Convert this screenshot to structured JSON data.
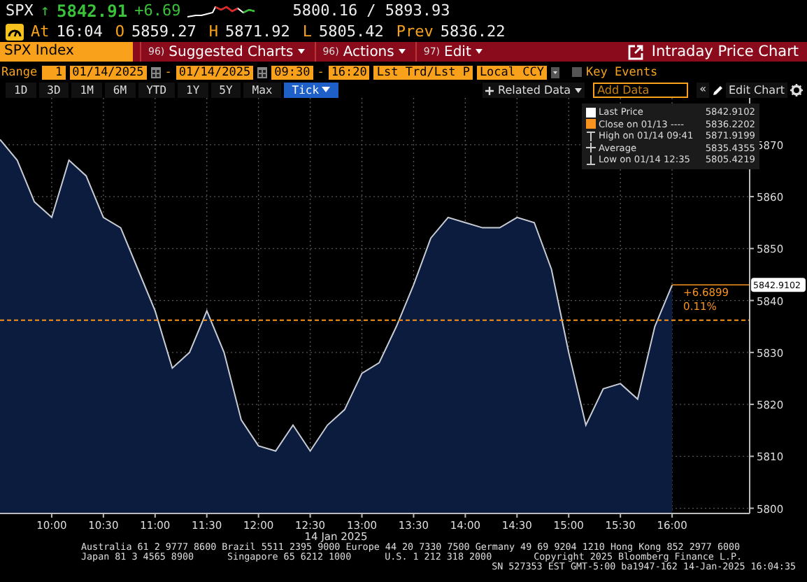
{
  "quote": {
    "ticker": "SPX",
    "arrow": "↑",
    "last": "5842.91",
    "change": "+6.69",
    "range": "5800.16 / 5893.93"
  },
  "stats": [
    {
      "label": "At",
      "value": "16:04"
    },
    {
      "label": "O",
      "value": "5859.27"
    },
    {
      "label": "H",
      "value": "5871.92"
    },
    {
      "label": "L",
      "value": "5805.42"
    },
    {
      "label": "Prev",
      "value": "5836.22"
    }
  ],
  "toolbar": {
    "security": "SPX Index",
    "menus": [
      {
        "code": "96)",
        "label": "Suggested Charts"
      },
      {
        "code": "96)",
        "label": "Actions"
      },
      {
        "code": "97)",
        "label": "Edit"
      }
    ],
    "title": "Intraday Price Chart"
  },
  "range_bar": {
    "label": "Range",
    "count": "1",
    "start_date": "01/14/2025",
    "date_separator": "-",
    "end_date": "01/14/2025",
    "start_time": "09:30",
    "time_separator": "-",
    "end_time": "16:20",
    "price_field": "Lst Trd/Lst P",
    "currency": "Local CCY",
    "key_events": {
      "label": "Key Events",
      "checked": false
    }
  },
  "period_buttons": [
    {
      "label": "1D",
      "selected": false
    },
    {
      "label": "3D",
      "selected": false
    },
    {
      "label": "1M",
      "selected": false
    },
    {
      "label": "6M",
      "selected": false
    },
    {
      "label": "YTD",
      "selected": false
    },
    {
      "label": "1Y",
      "selected": false
    },
    {
      "label": "5Y",
      "selected": false
    },
    {
      "label": "Max",
      "selected": false
    },
    {
      "label": "Tick",
      "selected": true
    }
  ],
  "chart_tools": {
    "related_data": "Related Data",
    "add_data_placeholder": "Add Data",
    "collapse": "«",
    "edit_chart": "Edit Chart"
  },
  "chart": {
    "legend": [
      {
        "kind": "square",
        "color": "#ffffff",
        "label": "Last Price",
        "value": "5842.9102"
      },
      {
        "kind": "square",
        "color": "#f7931e",
        "label": "Close on 01/13 ----",
        "value": "5836.2202"
      },
      {
        "kind": "high",
        "label": "High on 01/14 09:41",
        "value": "5871.9199"
      },
      {
        "kind": "average",
        "label": "Average",
        "value": "5835.4355"
      },
      {
        "kind": "low",
        "label": "Low on 01/14 12:35",
        "value": "5805.4219"
      }
    ],
    "last_tag": "5842.9102",
    "change_tag": "+6.6899",
    "percent_tag": "0.11%",
    "chart_data": {
      "type": "area",
      "xlabel": "14 Jan 2025",
      "x": [
        570,
        580,
        590,
        600,
        610,
        620,
        630,
        640,
        650,
        660,
        670,
        680,
        690,
        700,
        710,
        720,
        730,
        740,
        750,
        760,
        770,
        780,
        790,
        800,
        810,
        820,
        830,
        840,
        850,
        860,
        870,
        880,
        890,
        900,
        910,
        920,
        930,
        940,
        950,
        960
      ],
      "series": [
        {
          "color": "#0c1c3e",
          "values": [
            5871,
            5867,
            5859,
            5856,
            5867,
            5864,
            5856,
            5854,
            5846,
            5838,
            5827,
            5830,
            5838,
            5830,
            5817,
            5812,
            5811,
            5816,
            5811,
            5816,
            5819,
            5826,
            5828,
            5835,
            5843,
            5852,
            5856,
            5855,
            5854,
            5854,
            5856,
            5855,
            5846,
            5830,
            5816,
            5823,
            5824,
            5821,
            5835,
            5843
          ]
        }
      ],
      "xlim": [
        570,
        1005
      ],
      "ylim": [
        5799,
        5879
      ],
      "grid": true,
      "yticks": [
        5800,
        5810,
        5820,
        5830,
        5840,
        5850,
        5860,
        5870
      ],
      "xticks": [
        {
          "value": 600,
          "label": "10:00"
        },
        {
          "value": 630,
          "label": "10:30"
        },
        {
          "value": 660,
          "label": "11:00"
        },
        {
          "value": 690,
          "label": "11:30"
        },
        {
          "value": 720,
          "label": "12:00"
        },
        {
          "value": 750,
          "label": "12:30"
        },
        {
          "value": 780,
          "label": "13:00"
        },
        {
          "value": 810,
          "label": "13:30"
        },
        {
          "value": 840,
          "label": "14:00"
        },
        {
          "value": 870,
          "label": "14:30"
        },
        {
          "value": 900,
          "label": "15:00"
        },
        {
          "value": 930,
          "label": "15:30"
        },
        {
          "value": 960,
          "label": "16:00"
        }
      ],
      "ref_lines": [
        {
          "axis": "y",
          "value": 5836.22
        }
      ]
    }
  },
  "footer": {
    "line1": "Australia 61 2 9777 8600 Brazil 5511 2395 9000 Europe 44 20 7330 7500 Germany 49 69 9204 1210 Hong Kong 852 2977 6000",
    "line2": [
      "Japan 81 3 4565 8900",
      "Singapore 65 6212 1000",
      "U.S. 1 212 318 2000",
      "Copyright 2025 Bloomberg Finance L.P."
    ],
    "line3": "SN 527353 EST  GMT-5:00 ba1947-162 14-Jan-2025 16:04:35"
  }
}
